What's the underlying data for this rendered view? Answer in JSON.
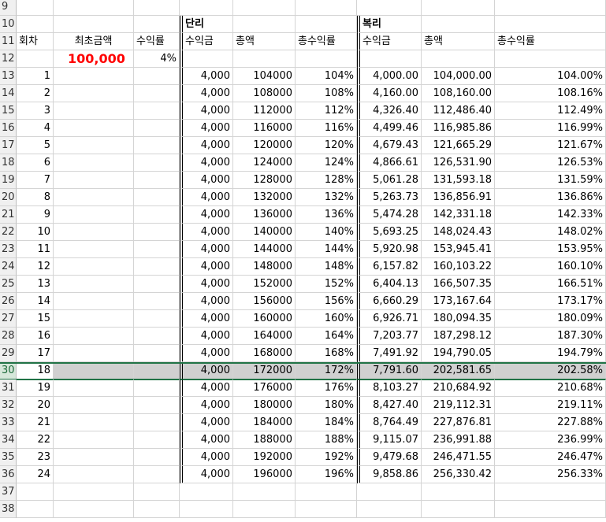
{
  "rows": [
    {
      "n": "9",
      "c": [
        "",
        "",
        "",
        "",
        "",
        "",
        "",
        "",
        ""
      ]
    },
    {
      "n": "10",
      "c": [
        "",
        "",
        "",
        "단리",
        "",
        "",
        "복리",
        "",
        ""
      ]
    },
    {
      "n": "11",
      "c": [
        "회차",
        "최초금액",
        "수익률",
        "수익금",
        "총액",
        "총수익률",
        "수익금",
        "총액",
        "총수익률"
      ]
    },
    {
      "n": "12",
      "c": [
        "",
        "100,000",
        "4%",
        "",
        "",
        "",
        "",
        "",
        ""
      ]
    },
    {
      "n": "13",
      "c": [
        "1",
        "",
        "",
        "4,000",
        "104000",
        "104%",
        "4,000.00",
        "104,000.00",
        "104.00%"
      ]
    },
    {
      "n": "14",
      "c": [
        "2",
        "",
        "",
        "4,000",
        "108000",
        "108%",
        "4,160.00",
        "108,160.00",
        "108.16%"
      ]
    },
    {
      "n": "15",
      "c": [
        "3",
        "",
        "",
        "4,000",
        "112000",
        "112%",
        "4,326.40",
        "112,486.40",
        "112.49%"
      ]
    },
    {
      "n": "16",
      "c": [
        "4",
        "",
        "",
        "4,000",
        "116000",
        "116%",
        "4,499.46",
        "116,985.86",
        "116.99%"
      ]
    },
    {
      "n": "17",
      "c": [
        "5",
        "",
        "",
        "4,000",
        "120000",
        "120%",
        "4,679.43",
        "121,665.29",
        "121.67%"
      ]
    },
    {
      "n": "18",
      "c": [
        "6",
        "",
        "",
        "4,000",
        "124000",
        "124%",
        "4,866.61",
        "126,531.90",
        "126.53%"
      ]
    },
    {
      "n": "19",
      "c": [
        "7",
        "",
        "",
        "4,000",
        "128000",
        "128%",
        "5,061.28",
        "131,593.18",
        "131.59%"
      ]
    },
    {
      "n": "20",
      "c": [
        "8",
        "",
        "",
        "4,000",
        "132000",
        "132%",
        "5,263.73",
        "136,856.91",
        "136.86%"
      ]
    },
    {
      "n": "21",
      "c": [
        "9",
        "",
        "",
        "4,000",
        "136000",
        "136%",
        "5,474.28",
        "142,331.18",
        "142.33%"
      ]
    },
    {
      "n": "22",
      "c": [
        "10",
        "",
        "",
        "4,000",
        "140000",
        "140%",
        "5,693.25",
        "148,024.43",
        "148.02%"
      ]
    },
    {
      "n": "23",
      "c": [
        "11",
        "",
        "",
        "4,000",
        "144000",
        "144%",
        "5,920.98",
        "153,945.41",
        "153.95%"
      ]
    },
    {
      "n": "24",
      "c": [
        "12",
        "",
        "",
        "4,000",
        "148000",
        "148%",
        "6,157.82",
        "160,103.22",
        "160.10%"
      ]
    },
    {
      "n": "25",
      "c": [
        "13",
        "",
        "",
        "4,000",
        "152000",
        "152%",
        "6,404.13",
        "166,507.35",
        "166.51%"
      ]
    },
    {
      "n": "26",
      "c": [
        "14",
        "",
        "",
        "4,000",
        "156000",
        "156%",
        "6,660.29",
        "173,167.64",
        "173.17%"
      ]
    },
    {
      "n": "27",
      "c": [
        "15",
        "",
        "",
        "4,000",
        "160000",
        "160%",
        "6,926.71",
        "180,094.35",
        "180.09%"
      ]
    },
    {
      "n": "28",
      "c": [
        "16",
        "",
        "",
        "4,000",
        "164000",
        "164%",
        "7,203.77",
        "187,298.12",
        "187.30%"
      ]
    },
    {
      "n": "29",
      "c": [
        "17",
        "",
        "",
        "4,000",
        "168000",
        "168%",
        "7,491.92",
        "194,790.05",
        "194.79%"
      ]
    },
    {
      "n": "30",
      "c": [
        "18",
        "",
        "",
        "4,000",
        "172000",
        "172%",
        "7,791.60",
        "202,581.65",
        "202.58%"
      ]
    },
    {
      "n": "31",
      "c": [
        "19",
        "",
        "",
        "4,000",
        "176000",
        "176%",
        "8,103.27",
        "210,684.92",
        "210.68%"
      ]
    },
    {
      "n": "32",
      "c": [
        "20",
        "",
        "",
        "4,000",
        "180000",
        "180%",
        "8,427.40",
        "219,112.31",
        "219.11%"
      ]
    },
    {
      "n": "33",
      "c": [
        "21",
        "",
        "",
        "4,000",
        "184000",
        "184%",
        "8,764.49",
        "227,876.81",
        "227.88%"
      ]
    },
    {
      "n": "34",
      "c": [
        "22",
        "",
        "",
        "4,000",
        "188000",
        "188%",
        "9,115.07",
        "236,991.88",
        "236.99%"
      ]
    },
    {
      "n": "35",
      "c": [
        "23",
        "",
        "",
        "4,000",
        "192000",
        "192%",
        "9,479.68",
        "246,471.55",
        "246.47%"
      ]
    },
    {
      "n": "36",
      "c": [
        "24",
        "",
        "",
        "4,000",
        "196000",
        "196%",
        "9,858.86",
        "256,330.42",
        "256.33%"
      ]
    },
    {
      "n": "37",
      "c": [
        "",
        "",
        "",
        "",
        "",
        "",
        "",
        "",
        ""
      ]
    },
    {
      "n": "38",
      "c": [
        "",
        "",
        "",
        "",
        "",
        "",
        "",
        "",
        ""
      ]
    }
  ],
  "selected_row": "30",
  "colors": {
    "accent": "#217346",
    "highlight": "#d0d0d0",
    "initial_amount": "#ff0000"
  }
}
